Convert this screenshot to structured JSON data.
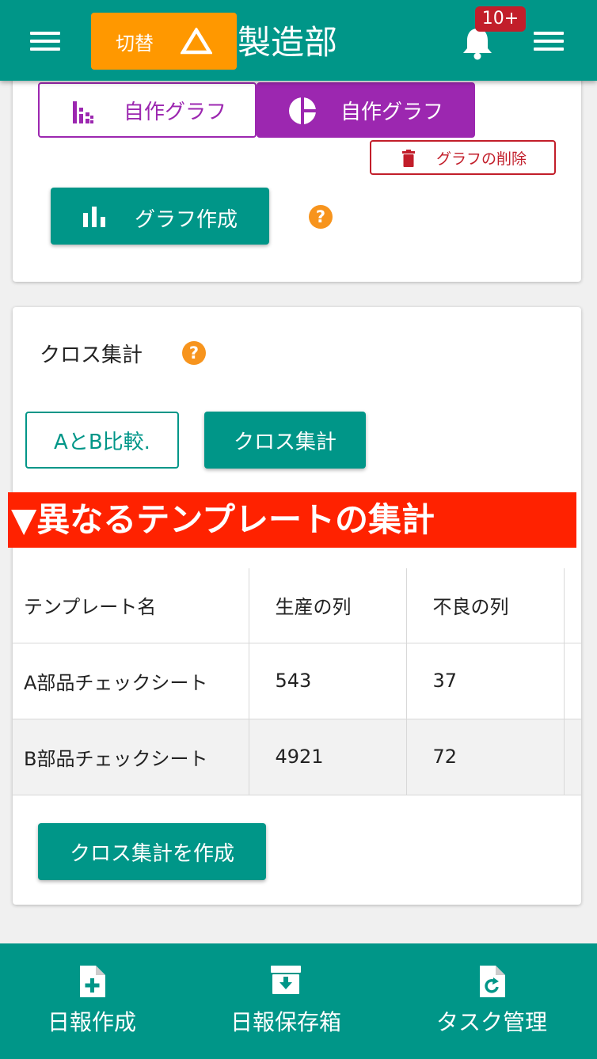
{
  "header": {
    "switch_label": "切替",
    "department": "製造部",
    "notification_count": "10+"
  },
  "graphs": {
    "tab_bar_label": "自作グラフ",
    "tab_pie_label": "自作グラフ",
    "delete_label": "グラフの削除",
    "create_label": "グラフ作成",
    "help": "?"
  },
  "cross": {
    "title": "クロス集計",
    "help": "?",
    "compare_label": "AとB比較.",
    "cross_label": "クロス集計",
    "banner": "▼異なるテンプレートの集計",
    "table": {
      "headers": [
        "テンプレート名",
        "生産の列",
        "不良の列",
        ""
      ],
      "rows": [
        [
          "A部品チェックシート",
          "543",
          "37",
          ""
        ],
        [
          "B部品チェックシート",
          "4921",
          "72",
          ""
        ]
      ]
    },
    "create_label": "クロス集計を作成"
  },
  "bottom_nav": {
    "items": [
      {
        "label": "日報作成",
        "icon": "file-plus-icon"
      },
      {
        "label": "日報保存箱",
        "icon": "archive-box-icon"
      },
      {
        "label": "タスク管理",
        "icon": "file-refresh-icon"
      }
    ]
  },
  "colors": {
    "primary": "#009688",
    "accent_orange": "#ff9800",
    "purple": "#9c27b0",
    "danger": "#c21e2a",
    "banner_red": "#ff2200"
  }
}
